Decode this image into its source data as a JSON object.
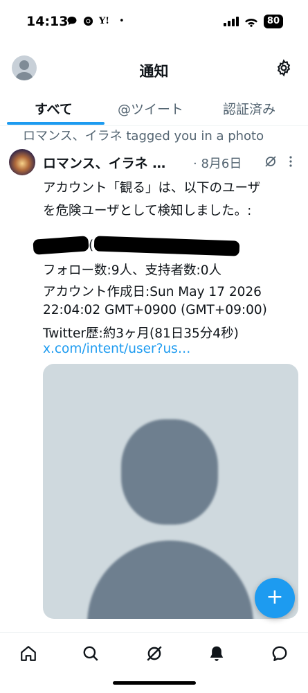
{
  "status_bar": {
    "time": "14:13",
    "app_icons": [
      "speech-bubble",
      "chrome",
      "Y!",
      "•"
    ],
    "battery": "80"
  },
  "header": {
    "title": "通知"
  },
  "tabs": [
    {
      "label": "すべて",
      "active": true
    },
    {
      "label": "@ツイート",
      "active": false
    },
    {
      "label": "認証済み",
      "active": false
    }
  ],
  "notification": {
    "context": "ロマンス、イラネ tagged you in a photo"
  },
  "tweet": {
    "author_name": "ロマンス、イラネ …",
    "date": "· 8月6日",
    "lines": [
      "アカウント「観る」は、以下のユーザ",
      "を危険ユーザとして検知しました。:",
      "フォロー数:9人、支持者数:0人",
      "アカウント作成日:Sun May 17 2026",
      "22:04:02 GMT+0900 (GMT+09:00)",
      "Twitter歴:約3ヶ月(81日35分4秒)"
    ],
    "link": "x.com/intent/user?us…"
  },
  "colors": {
    "accent": "#1d9bf0",
    "secondary_text": "#536471",
    "media_bg": "#cfd9de"
  },
  "bottom_nav": [
    "home-icon",
    "search-icon",
    "grok-icon",
    "notifications-icon",
    "messages-icon"
  ]
}
